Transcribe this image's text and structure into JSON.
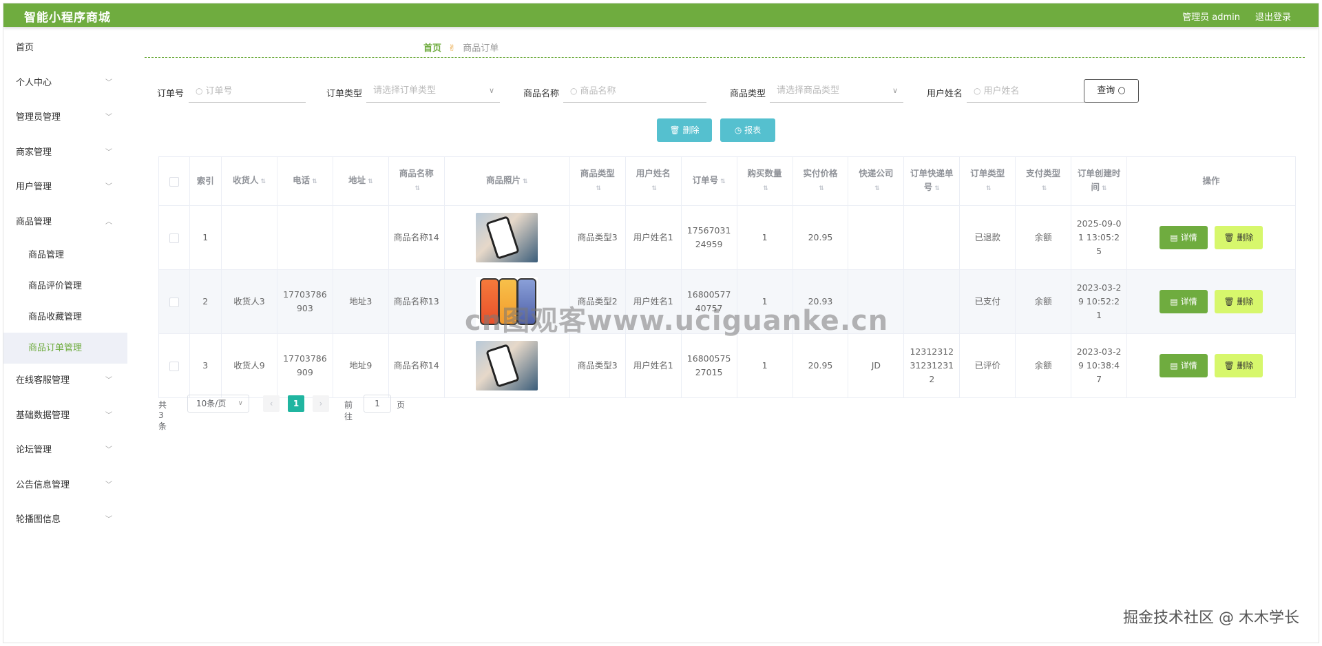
{
  "app": {
    "title": "智能小程序商城",
    "user_label": "管理员 admin",
    "logout": "退出登录"
  },
  "sidebar": {
    "items": [
      {
        "label": "首页",
        "chevron": ""
      },
      {
        "label": "个人中心",
        "chevron": "﹀"
      },
      {
        "label": "管理员管理",
        "chevron": "﹀"
      },
      {
        "label": "商家管理",
        "chevron": "﹀"
      },
      {
        "label": "用户管理",
        "chevron": "﹀"
      },
      {
        "label": "商品管理",
        "chevron": "︿"
      }
    ],
    "sub_items": [
      "商品管理",
      "商品评价管理",
      "商品收藏管理",
      "商品订单管理"
    ],
    "items_after": [
      {
        "label": "在线客服管理",
        "chevron": "﹀"
      },
      {
        "label": "基础数据管理",
        "chevron": "﹀"
      },
      {
        "label": "论坛管理",
        "chevron": "﹀"
      },
      {
        "label": "公告信息管理",
        "chevron": "﹀"
      },
      {
        "label": "轮播图信息",
        "chevron": "﹀"
      }
    ]
  },
  "breadcrumb": {
    "home": "首页",
    "current": "商品订单"
  },
  "search": {
    "order_no_label": "订单号",
    "order_no_placeholder": "订单号",
    "order_type_label": "订单类型",
    "order_type_placeholder": "请选择订单类型",
    "product_name_label": "商品名称",
    "product_name_placeholder": "商品名称",
    "product_type_label": "商品类型",
    "product_type_placeholder": "请选择商品类型",
    "user_name_label": "用户姓名",
    "user_name_placeholder": "用户姓名",
    "query_label": "查询"
  },
  "actions": {
    "delete": "删除",
    "report": "报表"
  },
  "table": {
    "headers": [
      "索引",
      "收货人",
      "电话",
      "地址",
      "商品名称",
      "商品照片",
      "商品类型",
      "用户姓名",
      "订单号",
      "购买数量",
      "实付价格",
      "快递公司",
      "订单快递单号",
      "订单类型",
      "支付类型",
      "订单创建时间",
      "操作"
    ],
    "rows": [
      {
        "index": "1",
        "receiver": "",
        "phone": "",
        "address": "",
        "product_name": "商品名称14",
        "product_type": "商品类型3",
        "user_name": "用户姓名1",
        "order_no": "1756703124959",
        "qty": "1",
        "price": "20.95",
        "express": "",
        "express_no": "",
        "order_type": "已退款",
        "pay_type": "余额",
        "created": "2025-09-01 13:05:25"
      },
      {
        "index": "2",
        "receiver": "收货人3",
        "phone": "17703786903",
        "address": "地址3",
        "product_name": "商品名称13",
        "product_type": "商品类型2",
        "user_name": "用户姓名1",
        "order_no": "1680057740757",
        "qty": "1",
        "price": "20.93",
        "express": "",
        "express_no": "",
        "order_type": "已支付",
        "pay_type": "余额",
        "created": "2023-03-29 10:52:21"
      },
      {
        "index": "3",
        "receiver": "收货人9",
        "phone": "17703786909",
        "address": "地址9",
        "product_name": "商品名称14",
        "product_type": "商品类型3",
        "user_name": "用户姓名1",
        "order_no": "1680057527015",
        "qty": "1",
        "price": "20.95",
        "express": "JD",
        "express_no": "1231231231231231 2",
        "order_type": "已评价",
        "pay_type": "余额",
        "created": "2023-03-29 10:38:47"
      }
    ],
    "op_detail": "详情",
    "op_delete": "删除"
  },
  "pager": {
    "total": "共 3 条",
    "page_size": "10条/页",
    "current": "1",
    "goto_prefix": "前往",
    "goto_value": "1",
    "goto_suffix": "页"
  },
  "watermark": "cn图观客www.uciguanke.cn",
  "credit": "掘金技术社区 @ 木木学长",
  "colors": {
    "header": "#6fac3f",
    "report_btn": "#55c0cf",
    "detail_btn": "#6fac3f",
    "delete_btn": "#d7f76c",
    "pager_active": "#20b5a0"
  }
}
